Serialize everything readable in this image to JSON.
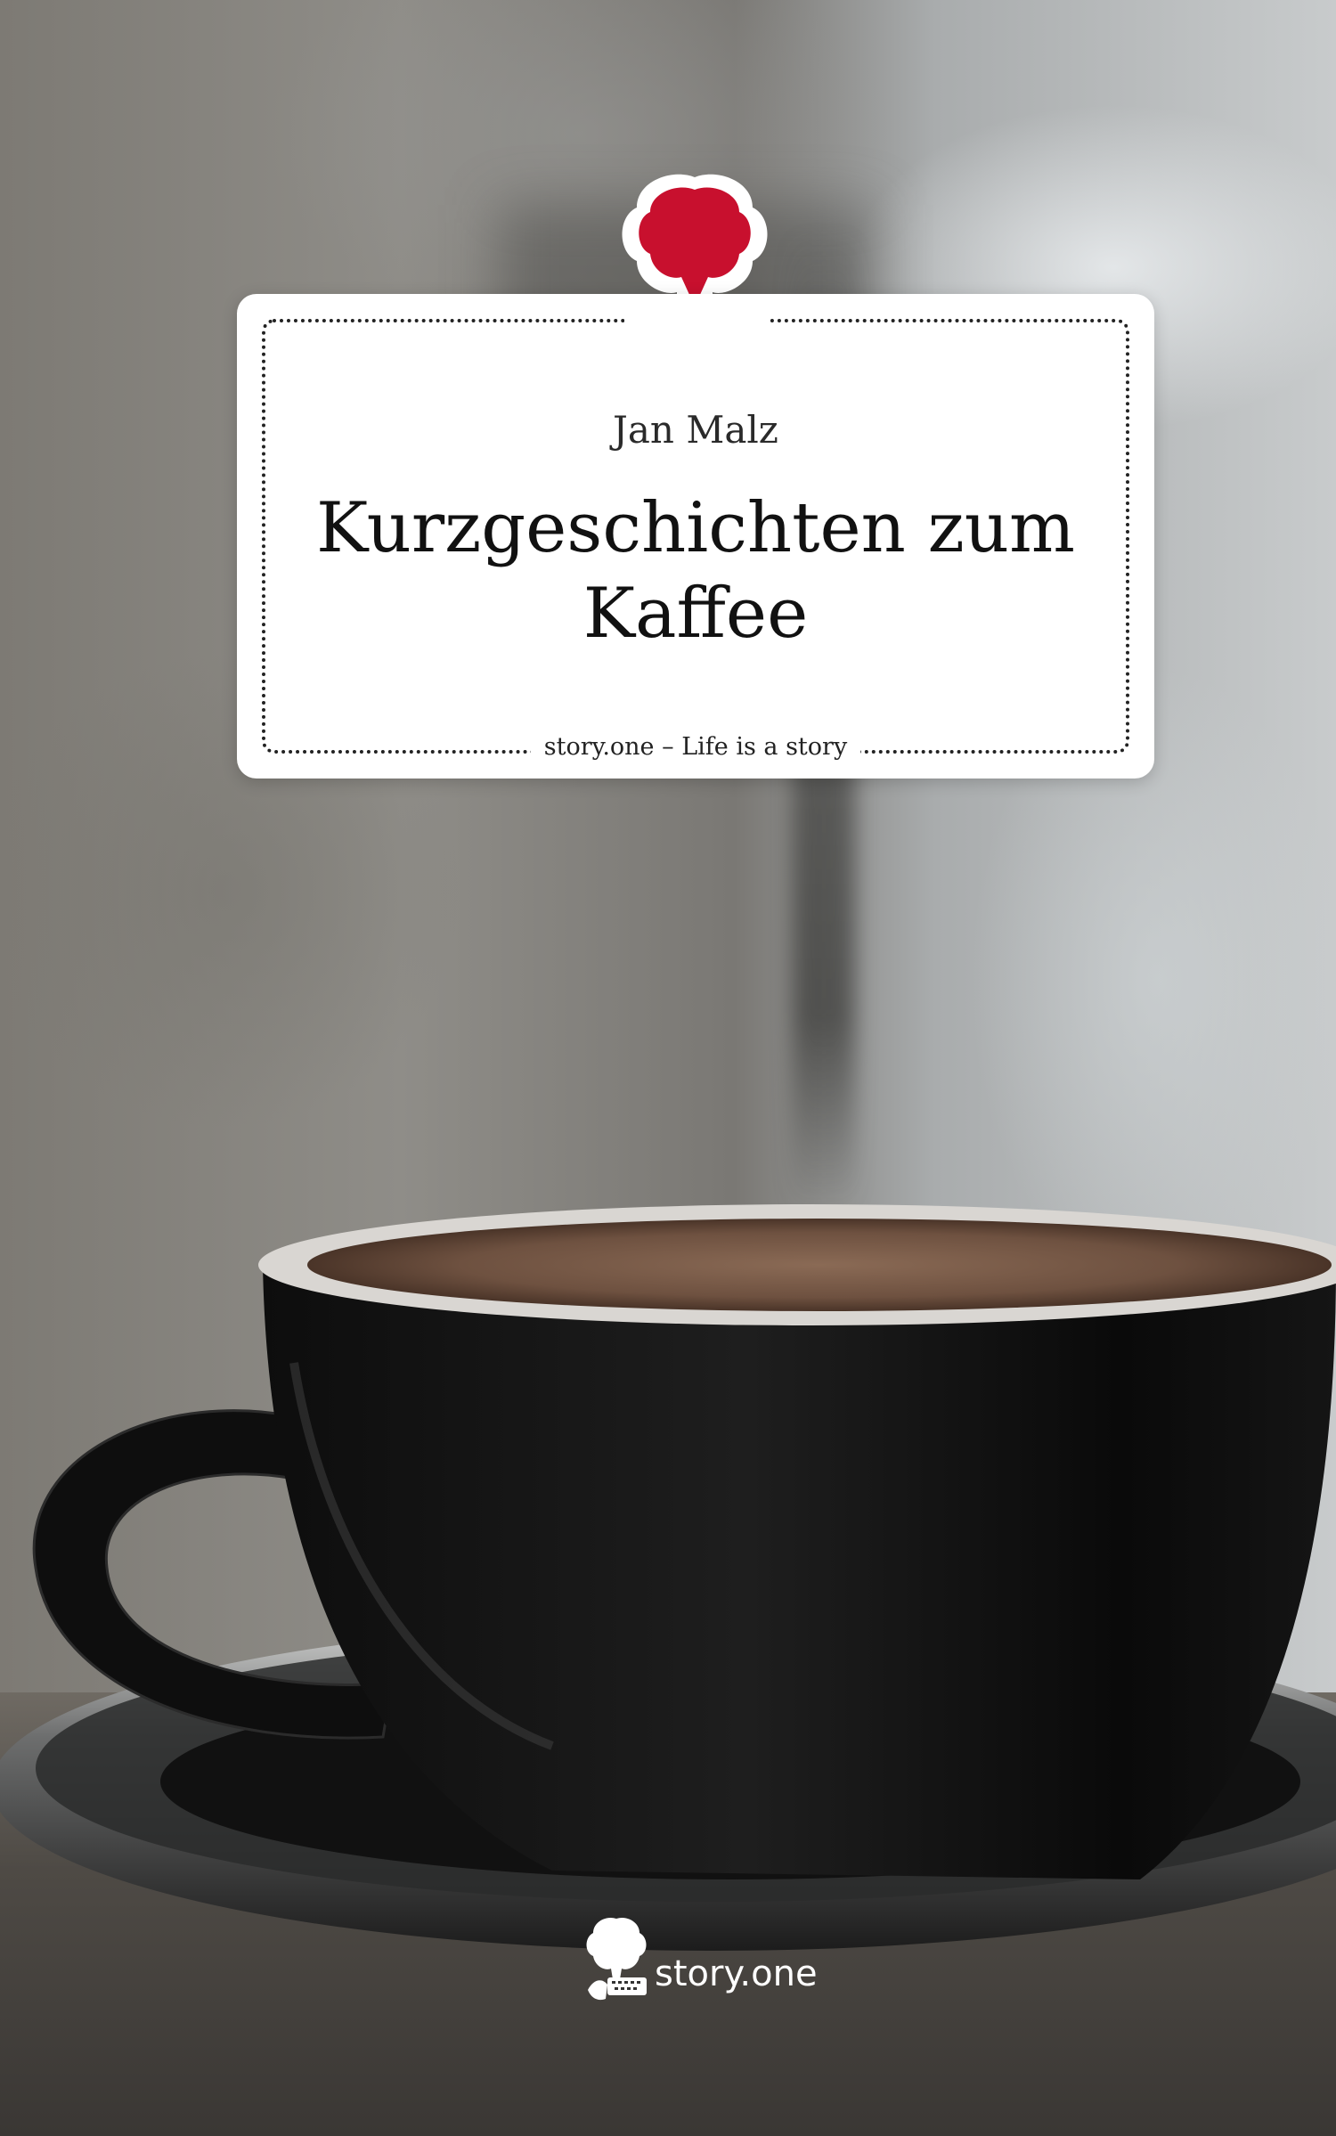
{
  "cover": {
    "author": "Jan Malz",
    "title": "Kurzgeschichten zum Kaffee",
    "tagline": "story.one – Life is a story",
    "publisher_brand": "story.one",
    "top_logo_icon": "tree-keyboard-logo-icon",
    "bottom_logo_icon": "tree-keyboard-logo-icon",
    "accent_color": "#c8102e"
  }
}
